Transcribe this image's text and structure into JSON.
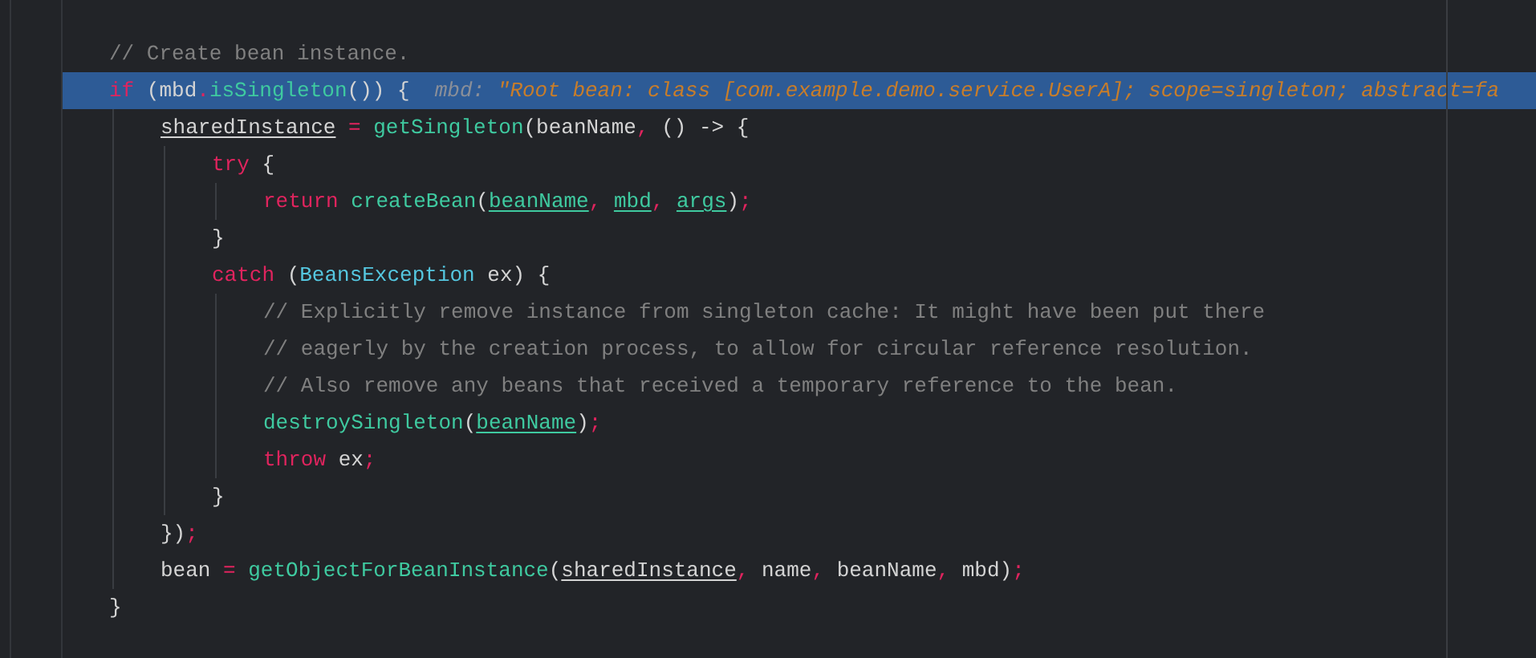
{
  "editor": {
    "lines": [
      {
        "selected": false,
        "tokens": [
          {
            "kind": "comment",
            "text": "// Create bean instance."
          }
        ]
      },
      {
        "selected": true,
        "tokens": [
          {
            "kind": "keyword",
            "text": "if"
          },
          {
            "kind": "plain",
            "text": " (mbd"
          },
          {
            "kind": "op",
            "text": "."
          },
          {
            "kind": "function",
            "text": "isSingleton"
          },
          {
            "kind": "plain",
            "text": "()) {  "
          },
          {
            "kind": "hint_name",
            "text": "mbd: "
          },
          {
            "kind": "hint_value",
            "text": "\"Root bean: class [com.example.demo.service.UserA]; scope=singleton; abstract=fa"
          }
        ],
        "children": [
          {
            "selected": false,
            "tokens": [
              {
                "kind": "field",
                "text": "sharedInstance"
              },
              {
                "kind": "op",
                "text": " = "
              },
              {
                "kind": "function",
                "text": "getSingleton"
              },
              {
                "kind": "plain",
                "text": "(beanName"
              },
              {
                "kind": "op",
                "text": ","
              },
              {
                "kind": "plain",
                "text": " () -> {"
              }
            ],
            "children": [
              {
                "selected": false,
                "tokens": [
                  {
                    "kind": "keyword",
                    "text": "try"
                  },
                  {
                    "kind": "plain",
                    "text": " {"
                  }
                ],
                "children": [
                  {
                    "selected": false,
                    "tokens": [
                      {
                        "kind": "keyword",
                        "text": "return "
                      },
                      {
                        "kind": "function",
                        "text": "createBean"
                      },
                      {
                        "kind": "plain",
                        "text": "("
                      },
                      {
                        "kind": "param",
                        "text": "beanName"
                      },
                      {
                        "kind": "op",
                        "text": ", "
                      },
                      {
                        "kind": "param",
                        "text": "mbd"
                      },
                      {
                        "kind": "op",
                        "text": ", "
                      },
                      {
                        "kind": "param",
                        "text": "args"
                      },
                      {
                        "kind": "plain",
                        "text": ")"
                      },
                      {
                        "kind": "op",
                        "text": ";"
                      }
                    ]
                  }
                ]
              },
              {
                "selected": false,
                "tokens": [
                  {
                    "kind": "plain",
                    "text": "}"
                  }
                ]
              },
              {
                "selected": false,
                "tokens": [
                  {
                    "kind": "keyword",
                    "text": "catch"
                  },
                  {
                    "kind": "plain",
                    "text": " ("
                  },
                  {
                    "kind": "type",
                    "text": "BeansException"
                  },
                  {
                    "kind": "plain",
                    "text": " ex) {"
                  }
                ],
                "children": [
                  {
                    "selected": false,
                    "tokens": [
                      {
                        "kind": "comment",
                        "text": "// Explicitly remove instance from singleton cache: It might have been put there"
                      }
                    ]
                  },
                  {
                    "selected": false,
                    "tokens": [
                      {
                        "kind": "comment",
                        "text": "// eagerly by the creation process, to allow for circular reference resolution."
                      }
                    ]
                  },
                  {
                    "selected": false,
                    "tokens": [
                      {
                        "kind": "comment",
                        "text": "// Also remove any beans that received a temporary reference to the bean."
                      }
                    ]
                  },
                  {
                    "selected": false,
                    "tokens": [
                      {
                        "kind": "function",
                        "text": "destroySingleton"
                      },
                      {
                        "kind": "plain",
                        "text": "("
                      },
                      {
                        "kind": "param",
                        "text": "beanName"
                      },
                      {
                        "kind": "plain",
                        "text": ")"
                      },
                      {
                        "kind": "op",
                        "text": ";"
                      }
                    ]
                  },
                  {
                    "selected": false,
                    "tokens": [
                      {
                        "kind": "keyword",
                        "text": "throw"
                      },
                      {
                        "kind": "plain",
                        "text": " ex"
                      },
                      {
                        "kind": "op",
                        "text": ";"
                      }
                    ]
                  }
                ]
              },
              {
                "selected": false,
                "tokens": [
                  {
                    "kind": "plain",
                    "text": "}"
                  }
                ]
              }
            ]
          },
          {
            "selected": false,
            "tokens": [
              {
                "kind": "plain",
                "text": "})"
              },
              {
                "kind": "op",
                "text": ";"
              }
            ]
          },
          {
            "selected": false,
            "tokens": [
              {
                "kind": "plain",
                "text": "bean"
              },
              {
                "kind": "op",
                "text": " = "
              },
              {
                "kind": "function",
                "text": "getObjectForBeanInstance"
              },
              {
                "kind": "plain",
                "text": "("
              },
              {
                "kind": "field",
                "text": "sharedInstance"
              },
              {
                "kind": "op",
                "text": ","
              },
              {
                "kind": "plain",
                "text": " name"
              },
              {
                "kind": "op",
                "text": ","
              },
              {
                "kind": "plain",
                "text": " beanName"
              },
              {
                "kind": "op",
                "text": ","
              },
              {
                "kind": "plain",
                "text": " mbd)"
              },
              {
                "kind": "op",
                "text": ";"
              }
            ]
          }
        ]
      },
      {
        "selected": false,
        "tokens": [
          {
            "kind": "plain",
            "text": "}"
          }
        ]
      }
    ]
  }
}
